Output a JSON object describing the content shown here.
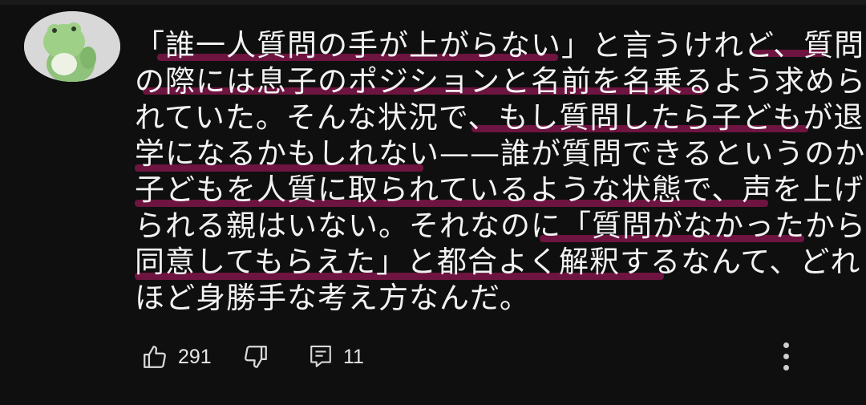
{
  "comment": {
    "lines": [
      "「誰一人質問の手が上がらない」と言うけれど、質問",
      "の際には息子のポジションと名前を名乗るよう求めら",
      "れていた。そんな状況で、もし質問したら子どもが退",
      "学になるかもしれない——誰が質問できるというのか。",
      "子どもを人質に取られているような状態で、声を上げ",
      "られる親はいない。それなのに「質問がなかったから",
      "同意してもらえた」と都合よく解釈するなんて、どれ",
      "ほど身勝手な考え方なんだ。"
    ],
    "highlight_color": "#6e1440"
  },
  "actions": {
    "likes": "291",
    "replies": "11"
  },
  "icons": {
    "like": "thumbs-up-icon",
    "dislike": "thumbs-down-icon",
    "reply": "comment-icon",
    "more": "more-vertical-icon"
  }
}
